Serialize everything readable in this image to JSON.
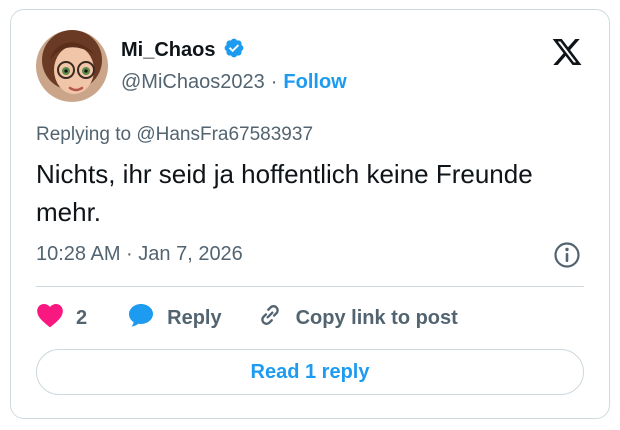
{
  "post": {
    "author_name": "Mi_Chaos",
    "handle": "@MiChaos2023",
    "separator": "·",
    "follow_label": "Follow",
    "replying_to": "Replying to @HansFra67583937",
    "text": "Nichts, ihr seid ja hoffentlich keine Freunde mehr.",
    "timestamp": "10:28 AM · Jan 7, 2026"
  },
  "actions": {
    "like_count": "2",
    "reply_label": "Reply",
    "copy_link_label": "Copy link to post"
  },
  "read_replies_label": "Read 1 reply",
  "icons": {
    "verified": "verified-badge-icon",
    "x_logo": "x-logo-icon",
    "info": "info-icon",
    "heart": "heart-icon",
    "reply": "reply-bubble-icon",
    "link": "link-icon"
  },
  "colors": {
    "accent": "#1d9bf0",
    "heart": "#f91880",
    "text": "#0f1419",
    "muted": "#536471",
    "border": "#cfd9de"
  }
}
